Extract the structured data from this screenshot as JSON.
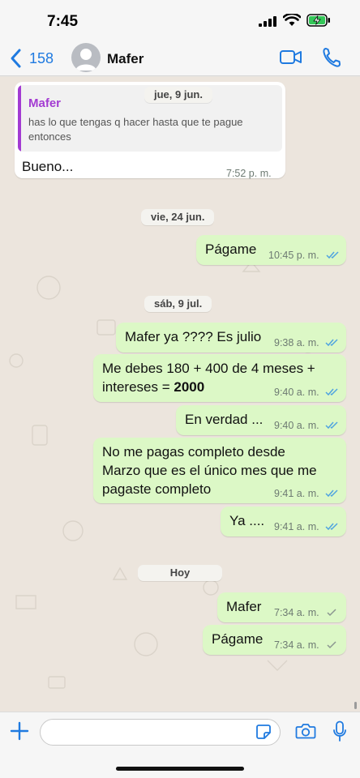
{
  "status_bar": {
    "time": "7:45"
  },
  "header": {
    "back_count": "158",
    "contact_name": "Mafer"
  },
  "chat": {
    "dates": {
      "d1": "jue, 9 jun.",
      "d2": "vie, 24 jun.",
      "d3": "sáb, 9 jul.",
      "d4": "Hoy"
    },
    "reply": {
      "quoted_name": "Mafer",
      "quoted_text": "has lo que tengas q hacer hasta que te pague entonces",
      "text": "Bueno...",
      "time": "7:52 p. m."
    },
    "messages": [
      {
        "text": "Págame",
        "time": "10:45 p. m.",
        "status": "read"
      },
      {
        "text": "Mafer ya  ???? Es julio",
        "time": "9:38 a. m.",
        "status": "read"
      },
      {
        "line1": "Me debes 180 + 400 de 4 meses +",
        "line2_prefix": "intereses = ",
        "line2_bold": "2000",
        "time": "9:40 a. m.",
        "status": "read"
      },
      {
        "text": "En verdad ...",
        "time": "9:40 a. m.",
        "status": "read"
      },
      {
        "line1": "No me pagas completo desde",
        "line2": "Marzo que es el único mes que me",
        "line3": "pagaste completo",
        "time": "9:41 a. m.",
        "status": "read"
      },
      {
        "text": "Ya ....",
        "time": "9:41 a. m.",
        "status": "read"
      },
      {
        "text": "Mafer",
        "time": "7:34 a. m.",
        "status": "delivered"
      },
      {
        "text": "Págame",
        "time": "7:34 a. m.",
        "status": "delivered"
      }
    ]
  },
  "input": {
    "placeholder": ""
  },
  "colors": {
    "outgoing": "#dcf8c6",
    "incoming": "#ffffff",
    "accent": "#1f7ae0",
    "quote_name": "#a33bd2",
    "read_ticks": "#4fa3e0"
  }
}
